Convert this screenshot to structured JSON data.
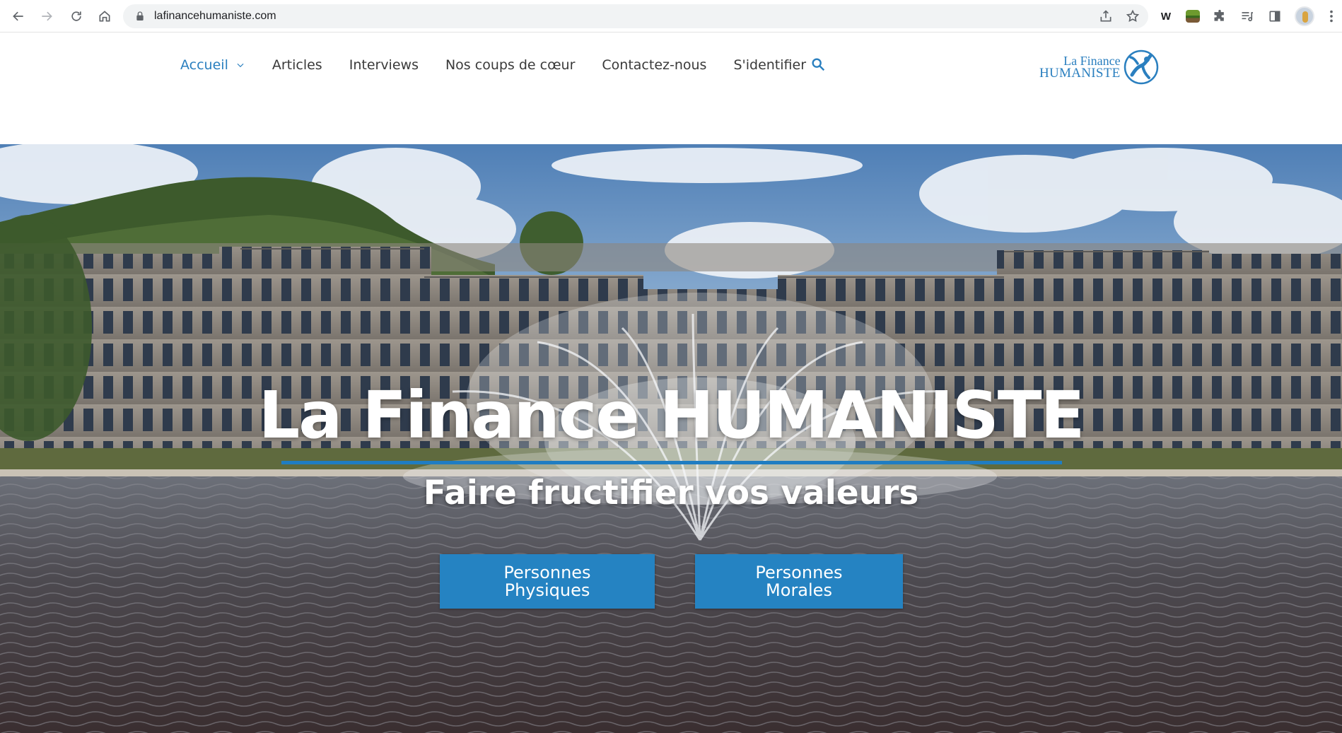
{
  "browser": {
    "url": "lafinancehumaniste.com",
    "extensions": [
      "share-icon",
      "star-icon",
      "w-extension-icon",
      "garden-extension-icon",
      "puzzle-icon",
      "media-icon",
      "side-panel-icon",
      "avatar"
    ],
    "w_ext_label": "W"
  },
  "header": {
    "menu": [
      {
        "label": "Accueil",
        "active": true,
        "has_dropdown": true
      },
      {
        "label": "Articles"
      },
      {
        "label": "Interviews"
      },
      {
        "label": "Nos coups de cœur"
      },
      {
        "label": "Contactez-nous"
      },
      {
        "label": "S'identifier"
      }
    ],
    "logo": {
      "line1": "La Finance",
      "line2": "HUMANISTE"
    }
  },
  "hero": {
    "title": "La Finance HUMANISTE",
    "subtitle": "Faire fructifier vos valeurs",
    "buttons": [
      {
        "line1": "Personnes",
        "line2": "Physiques"
      },
      {
        "line1": "Personnes",
        "line2": "Morales"
      }
    ]
  },
  "colors": {
    "accent": "#2a7fbf",
    "button": "#2583c2",
    "rule": "#1f7dc2"
  }
}
